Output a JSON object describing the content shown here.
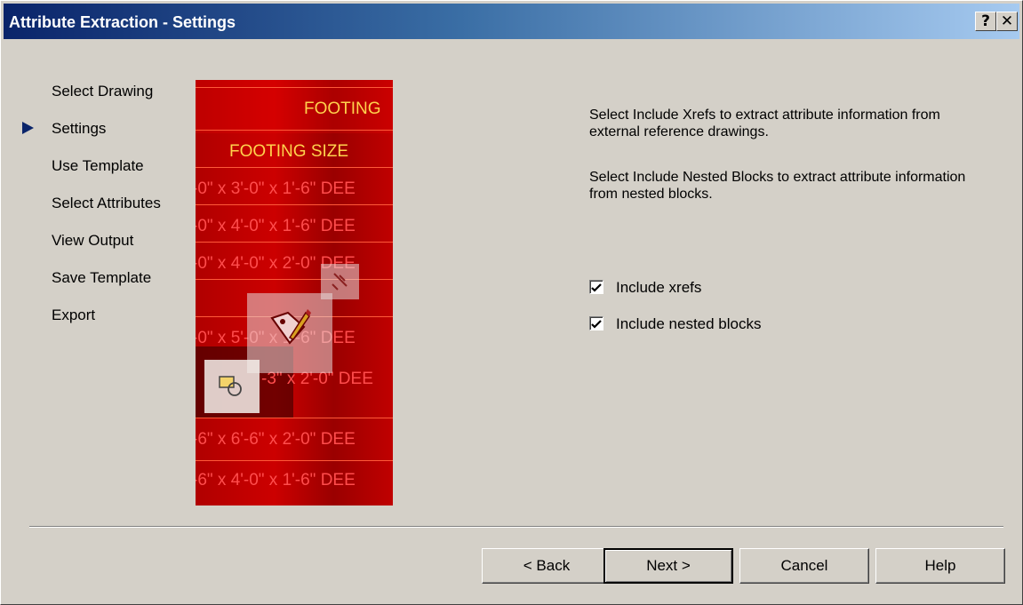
{
  "window": {
    "title": "Attribute Extraction - Settings",
    "help_button": "?",
    "close_button": "✕"
  },
  "steps": [
    {
      "label": "Select Drawing",
      "current": false
    },
    {
      "label": "Settings",
      "current": true
    },
    {
      "label": "Use Template",
      "current": false
    },
    {
      "label": "Select Attributes",
      "current": false
    },
    {
      "label": "View Output",
      "current": false
    },
    {
      "label": "Save Template",
      "current": false
    },
    {
      "label": "Export",
      "current": false
    }
  ],
  "artwork": {
    "lines": [
      "FOOTING",
      "FOOTING SIZE",
      "-0\" x 3'-0\" x 1'-6\" DEE",
      "-0\" x 4'-0\" x 1'-6\" DEE",
      "-0\" x 4'-0\" x 2'-0\" DEE",
      "-0\" x 5'-0\" x 1'-6\" DEE",
      "-3\" x 2'-0\" DEE",
      "-6\" x 6'-6\" x 2'-0\" DEE",
      "-6\" x 4'-0\" x 1'-6\" DEE"
    ]
  },
  "description": {
    "paragraph1": "Select Include Xrefs to extract attribute information from external reference drawings.",
    "paragraph2": "Select Include Nested Blocks to extract attribute information from nested blocks."
  },
  "options": {
    "include_xrefs": {
      "label": "Include xrefs",
      "checked": true
    },
    "include_nested": {
      "label": "Include nested blocks",
      "checked": true
    }
  },
  "buttons": {
    "back": "< Back",
    "next": "Next >",
    "cancel": "Cancel",
    "help": "Help"
  },
  "colors": {
    "titlebar_start": "#0a246a",
    "titlebar_end": "#a6caf0",
    "dialog_bg": "#d4d0c8",
    "current_step_marker": "#0a246a"
  }
}
